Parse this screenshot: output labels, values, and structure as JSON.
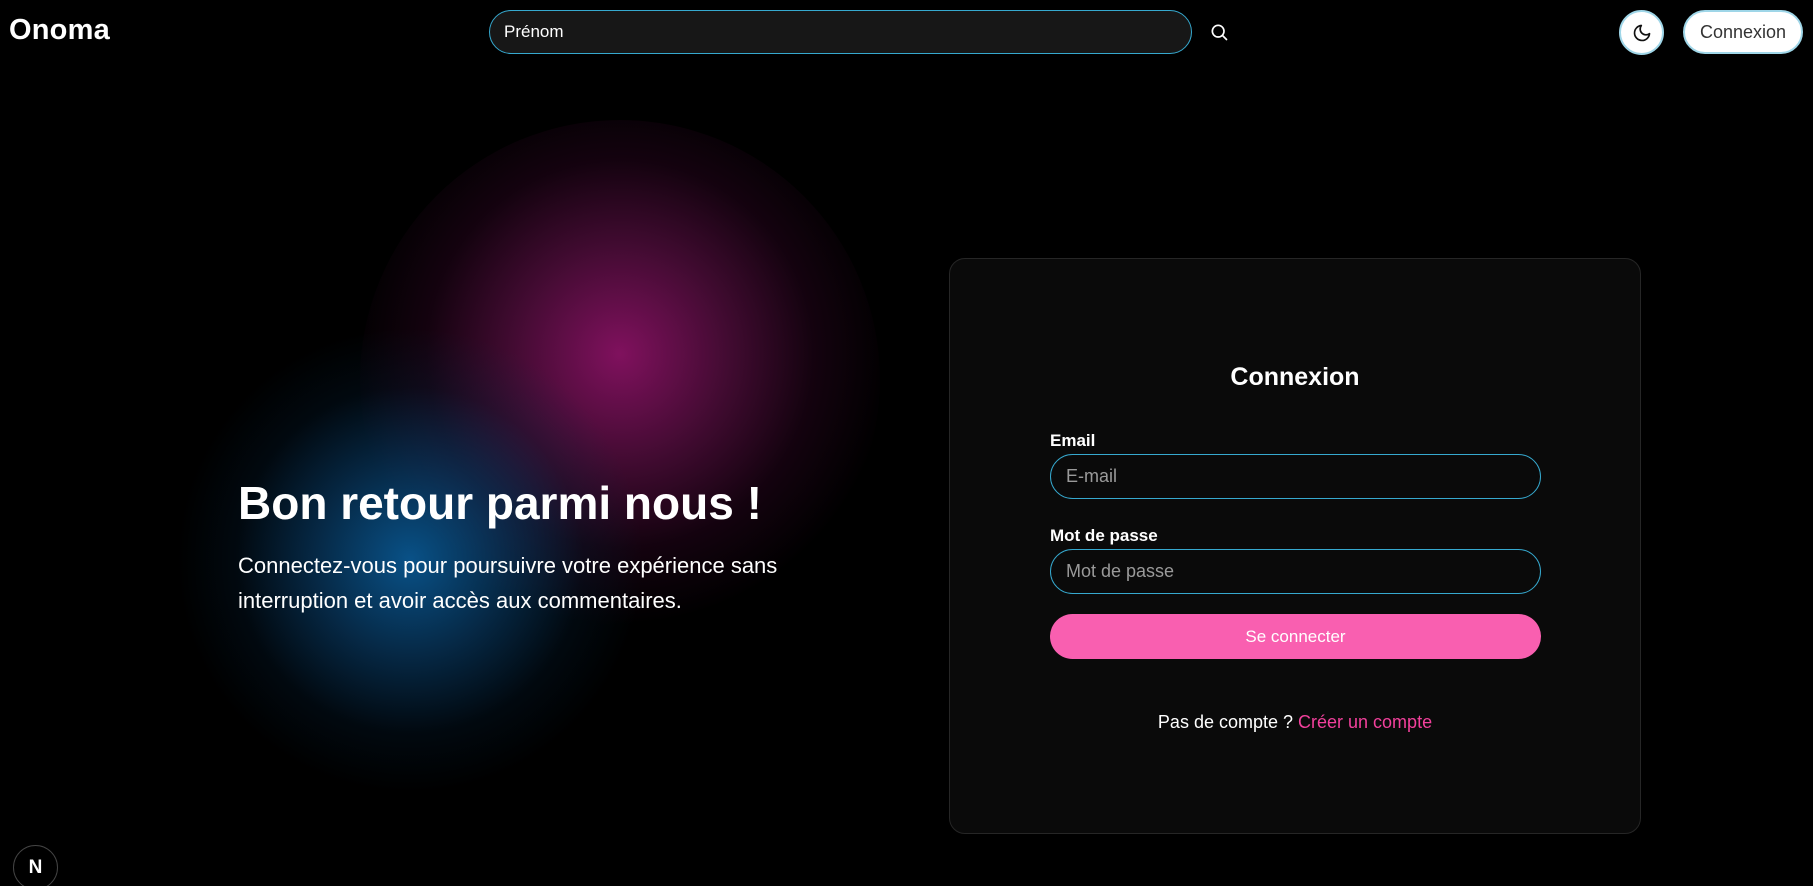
{
  "header": {
    "logo": "Onoma",
    "search": {
      "value": "Prénom",
      "placeholder": "Prénom"
    },
    "search_icon": "search-icon",
    "theme_icon": "moon-icon",
    "login_label": "Connexion"
  },
  "hero": {
    "title": "Bon retour parmi nous !",
    "subtitle": "Connectez-vous pour poursuivre votre expérience sans interruption et avoir accès aux commentaires."
  },
  "login_card": {
    "title": "Connexion",
    "email_label": "Email",
    "email_placeholder": "E-mail",
    "email_value": "",
    "password_label": "Mot de passe",
    "password_placeholder": "Mot de passe",
    "password_value": "",
    "submit_label": "Se connecter",
    "signup_prompt": "Pas de compte ?",
    "signup_link": "Créer un compte"
  },
  "dev_badge": {
    "label": "N",
    "icon": "nextjs-icon"
  },
  "colors": {
    "background": "#000000",
    "accent_blue": "#36a9cf",
    "accent_pink": "#f95fb0",
    "link_pink": "#f2409c",
    "card": "#0a0a0a"
  }
}
